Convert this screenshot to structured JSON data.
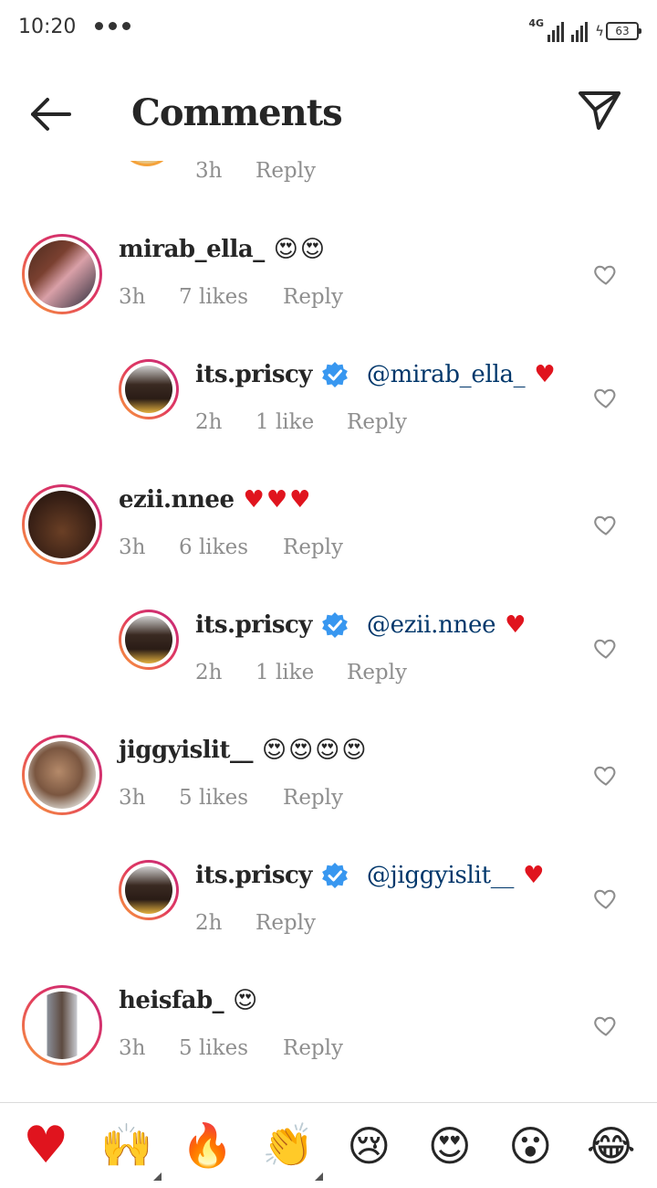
{
  "status_bar": {
    "time": "10:20",
    "network": "4G",
    "battery": "63"
  },
  "header": {
    "title": "Comments"
  },
  "partial_comment": {
    "time": "3h",
    "reply_label": "Reply"
  },
  "comments": [
    {
      "kind": "top",
      "username": "mirab_ella_",
      "text": "😍😍",
      "time": "3h",
      "likes": "7 likes",
      "reply_label": "Reply",
      "avatar_icon": "user-photo-avatar"
    },
    {
      "kind": "reply",
      "username": "its.priscy",
      "verified": true,
      "mention": "@mirab_ella_",
      "text": "♥",
      "time": "2h",
      "likes": "1 like",
      "reply_label": "Reply",
      "avatar_icon": "user-photo-avatar"
    },
    {
      "kind": "top",
      "username": "ezii.nnee",
      "text": "♥♥♥",
      "time": "3h",
      "likes": "6 likes",
      "reply_label": "Reply",
      "avatar_icon": "user-photo-avatar"
    },
    {
      "kind": "reply",
      "username": "its.priscy",
      "verified": true,
      "mention": "@ezii.nnee",
      "text": "♥",
      "time": "2h",
      "likes": "1 like",
      "reply_label": "Reply",
      "avatar_icon": "user-photo-avatar"
    },
    {
      "kind": "top",
      "username": "jiggyislit__",
      "text": "😍😍😍😍",
      "time": "3h",
      "likes": "5 likes",
      "reply_label": "Reply",
      "avatar_icon": "user-photo-avatar"
    },
    {
      "kind": "reply",
      "username": "its.priscy",
      "verified": true,
      "mention": "@jiggyislit__",
      "text": "♥",
      "time": "2h",
      "likes": "",
      "reply_label": "Reply",
      "avatar_icon": "user-photo-avatar"
    },
    {
      "kind": "top",
      "username": "heisfab_",
      "text": "😍",
      "time": "3h",
      "likes": "5 likes",
      "reply_label": "Reply",
      "avatar_icon": "user-photo-avatar"
    }
  ],
  "reactions": [
    {
      "name": "red-heart",
      "glyph": "♥"
    },
    {
      "name": "raising-hands",
      "glyph": "🙌"
    },
    {
      "name": "fire",
      "glyph": "🔥"
    },
    {
      "name": "clapping-hands",
      "glyph": "👏"
    },
    {
      "name": "crying-face",
      "glyph": "😢"
    },
    {
      "name": "heart-eyes",
      "glyph": "😍"
    },
    {
      "name": "surprised-face",
      "glyph": "😮"
    },
    {
      "name": "tears-of-joy",
      "glyph": "😂"
    }
  ],
  "colors": {
    "username": "#262626",
    "meta": "#8e8e8e",
    "mention": "#00376b",
    "verified": "#3897f0",
    "heart": "#e0141e",
    "ring_start": "#f9a03a",
    "ring_end": "#c3287c"
  }
}
